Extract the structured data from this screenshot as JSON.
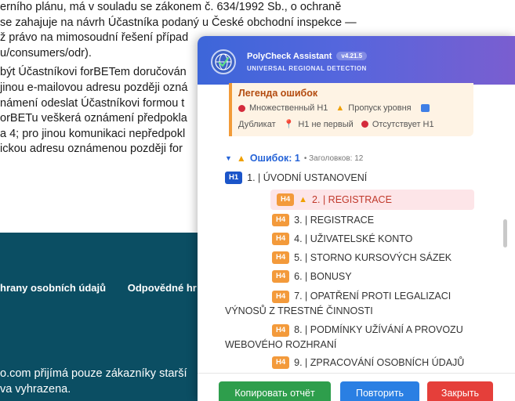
{
  "background": {
    "lines": [
      "erního plánu, má v souladu se zákonem č. 634/1992 Sb., o ochraně",
      "se zahajuje na návrh Účastníka podaný u České obchodní inspekce —",
      "ž právo na mimosoudní řešení případ",
      "u/consumers/odr).",
      "být Účastníkovi forBETem doručován",
      "jinou e-mailovou adresu později ozná",
      "námení odeslat Účastníkovi formou t",
      "orBETu veškerá oznámení předpokla",
      "a 4; pro jinou komunikaci nepředpokl",
      "ickou adresu oznámenou později for"
    ],
    "footer_links": [
      "hrany osobních údajů",
      "Odpovědné hr"
    ],
    "footer_copy": [
      "o.com přijímá pouze zákazníky starší",
      "va vyhrazena."
    ]
  },
  "panel": {
    "app_name": "PolyCheck Assistant",
    "version": "v4.21.5",
    "subtitle": "UNIVERSAL REGIONAL DETECTION",
    "legend": {
      "title": "Легенда ошибок",
      "items_row1": [
        "Множественный H1",
        "Пропуск уровня"
      ],
      "items_row2": [
        "Дубликат",
        "H1 не первый",
        "Отсутствует H1"
      ]
    },
    "errors": {
      "label": "Ошибок: 1",
      "meta": "• Заголовков: 12"
    },
    "headings": [
      {
        "level": "H1",
        "text": "1. | ÚVODNÍ USTANOVENÍ"
      },
      {
        "level": "H4",
        "text": "2. | REGISTRACE",
        "flagged": true
      },
      {
        "level": "H4",
        "text": "3. | REGISTRACE"
      },
      {
        "level": "H4",
        "text": "4. | UŽIVATELSKÉ KONTO"
      },
      {
        "level": "H4",
        "text": "5. | STORNO KURSOVÝCH SÁZEK"
      },
      {
        "level": "H4",
        "text": "6. | BONUSY"
      },
      {
        "level": "H4",
        "text": "7. | OPATŘENÍ PROTI LEGALIZACI",
        "text2": "VÝNOSŮ Z TRESTNÉ ČINNOSTI"
      },
      {
        "level": "H4",
        "text": "8. | PODMÍNKY UŽÍVÁNÍ A PROVOZU",
        "text2": "WEBOVÉHO ROZHRANÍ"
      },
      {
        "level": "H4",
        "text": "9. | ZPRACOVÁNÍ OSOBNÍCH ÚDAJŮ"
      }
    ],
    "buttons": {
      "copy": "Копировать отчёт",
      "retry": "Повторить",
      "close": "Закрыть"
    },
    "colors": {
      "h1_badge": "#1b55c9",
      "h4_badge": "#f39a3b",
      "copy": "#2e9e4c",
      "retry": "#2a7fe3",
      "close": "#e53f3a",
      "error_highlight": "#fde5e8"
    }
  }
}
